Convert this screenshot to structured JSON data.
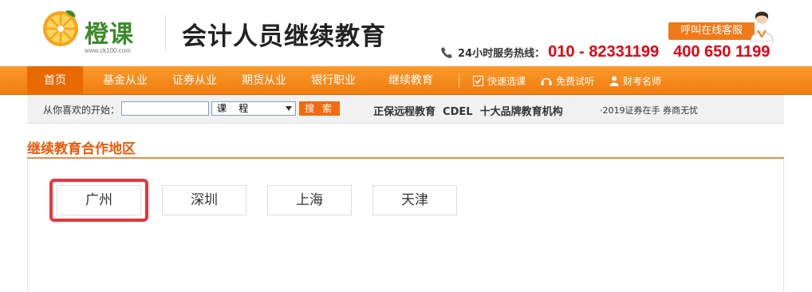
{
  "header": {
    "logo_text": "橙课",
    "logo_url_text": "www.ck100.com",
    "site_title": "会计人员继续教育",
    "service_button": "呼叫在线客服",
    "hotline_label": "24小时服务热线：",
    "hotline_number_1": "010 - 82331199",
    "hotline_number_2": "400 650 1199",
    "colors": {
      "accent_orange": "#f07c0f",
      "hotline_red": "#e60012",
      "logo_green": "#3c8a2a"
    }
  },
  "nav": {
    "items": [
      {
        "label": "首页",
        "active": true
      },
      {
        "label": "基金从业"
      },
      {
        "label": "证券从业"
      },
      {
        "label": "期货从业"
      },
      {
        "label": "银行职业"
      },
      {
        "label": "继续教育"
      }
    ],
    "icon_items": [
      {
        "label": "快速选课",
        "icon": "checkbox-icon"
      },
      {
        "label": "免费试听",
        "icon": "headphones-icon"
      },
      {
        "label": "财考名师",
        "icon": "teacher-icon"
      }
    ]
  },
  "searchbar": {
    "label": "从你喜欢的开始：",
    "input_value": "",
    "select_value": "课    程",
    "button": "搜 索",
    "slogan": "正保远程教育  CDEL  十大品牌教育机构",
    "news": "·2019证券在手 券商无忧"
  },
  "section": {
    "title": "继续教育合作地区",
    "cities": [
      "广州",
      "深圳",
      "上海",
      "天津"
    ],
    "highlighted_city": "广州"
  }
}
